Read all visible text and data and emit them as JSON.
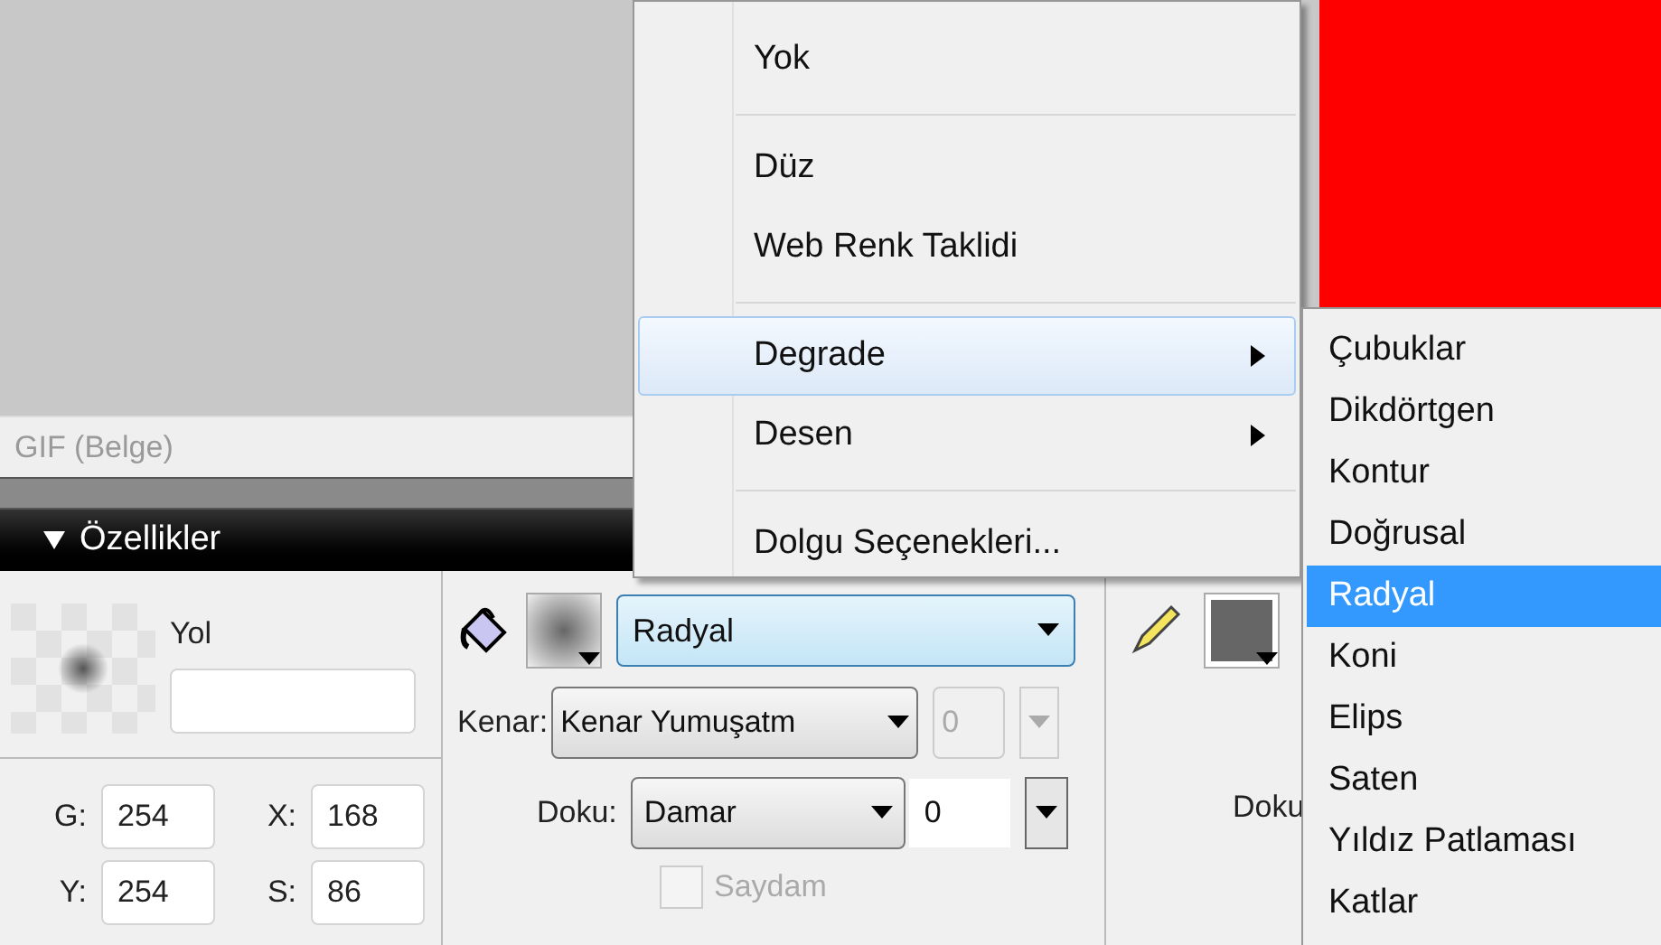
{
  "document": {
    "status": "GIF (Belge)"
  },
  "panel": {
    "title": "Özellikler",
    "expanded": true,
    "object_type": "Yol",
    "fields": [
      {
        "label": "G:",
        "value": "254"
      },
      {
        "label": "X:",
        "value": "168"
      },
      {
        "label": "Y:",
        "value": "254"
      },
      {
        "label": "S:",
        "value": "86"
      }
    ],
    "fill": {
      "type": "Radyal",
      "edge_label": "Kenar:",
      "edge_value": "Kenar Yumuşatm",
      "edge_amount": "0",
      "edge_amount_disabled": true,
      "texture_label": "Doku:",
      "texture_value": "Damar",
      "texture_amount": "0",
      "transparent": {
        "label": "Saydam",
        "checked": false,
        "disabled": true
      }
    },
    "stroke": {
      "texture_label": "Doku"
    }
  },
  "fill_menu": {
    "items": [
      {
        "kind": "item",
        "label": "Yok",
        "selected": false,
        "has_submenu": false
      },
      {
        "kind": "separator"
      },
      {
        "kind": "item",
        "label": "Düz",
        "selected": false,
        "has_submenu": false
      },
      {
        "kind": "item",
        "label": "Web Renk Taklidi",
        "selected": false,
        "has_submenu": false
      },
      {
        "kind": "separator"
      },
      {
        "kind": "item",
        "label": "Degrade",
        "selected": true,
        "has_submenu": true
      },
      {
        "kind": "item",
        "label": "Desen",
        "selected": false,
        "has_submenu": true
      },
      {
        "kind": "separator"
      },
      {
        "kind": "item",
        "label": "Dolgu Seçenekleri...",
        "selected": false,
        "has_submenu": false
      }
    ]
  },
  "gradient_submenu": {
    "items": [
      {
        "label": "Çubuklar",
        "selected": false
      },
      {
        "label": "Dikdörtgen",
        "selected": false
      },
      {
        "label": "Kontur",
        "selected": false
      },
      {
        "label": "Doğrusal",
        "selected": false
      },
      {
        "label": "Radyal",
        "selected": true
      },
      {
        "label": "Koni",
        "selected": false
      },
      {
        "label": "Elips",
        "selected": false
      },
      {
        "label": "Saten",
        "selected": false
      },
      {
        "label": "Yıldız Patlaması",
        "selected": false
      },
      {
        "label": "Katlar",
        "selected": false
      }
    ]
  }
}
